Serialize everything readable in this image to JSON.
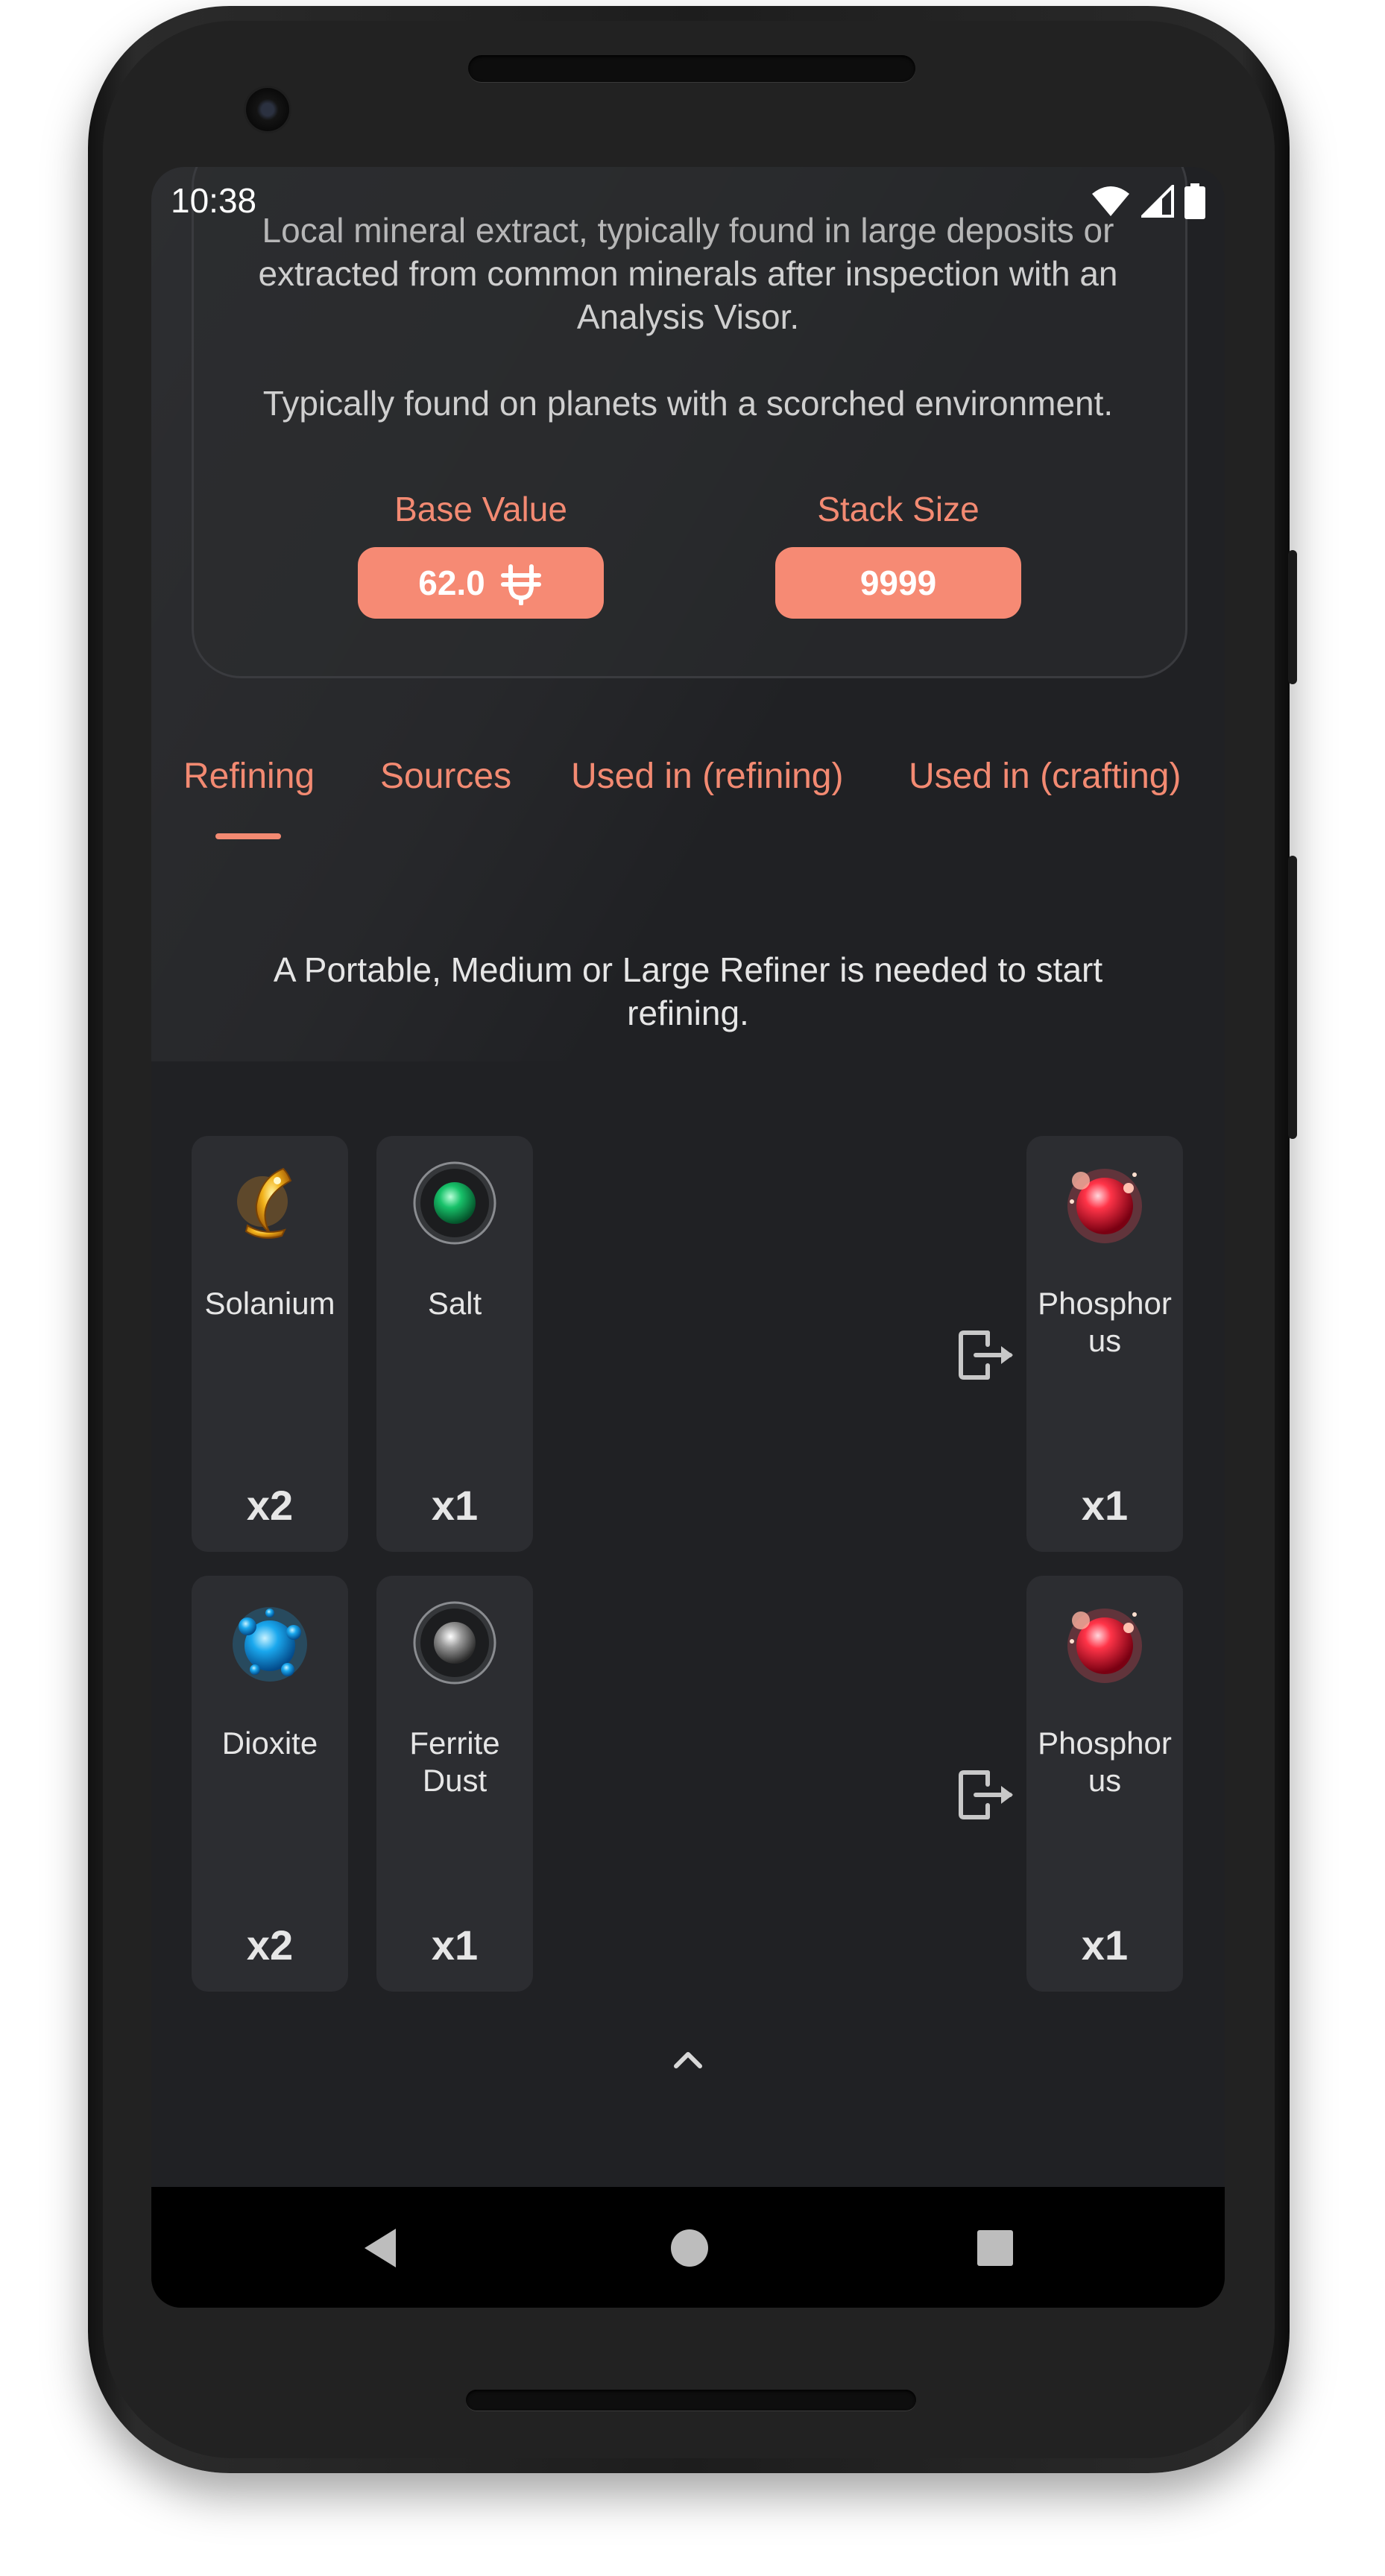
{
  "status_bar": {
    "time": "10:38"
  },
  "item_info": {
    "description_top": "Local mineral extract, typically found in large deposits or",
    "description_mid_1": "extracted from common minerals after inspection with an",
    "description_mid_2": "Analysis Visor.",
    "environment": "Typically found on planets with a scorched environment.",
    "base_value_label": "Base Value",
    "base_value": "62.0",
    "stack_size_label": "Stack Size",
    "stack_size": "9999"
  },
  "tabs": [
    {
      "label": "Refining",
      "selected": true
    },
    {
      "label": "Sources",
      "selected": false
    },
    {
      "label": "Used in (refining)",
      "selected": false
    },
    {
      "label": "Used in (crafting)",
      "selected": false
    }
  ],
  "refining": {
    "note_line_1": "A Portable, Medium or Large Refiner is needed to start",
    "note_line_2": "refining.",
    "recipes": [
      {
        "inputs": [
          {
            "name": "Solanium",
            "qty": "x2",
            "icon": "solanium-icon"
          },
          {
            "name": "Salt",
            "qty": "x1",
            "icon": "salt-icon"
          }
        ],
        "output": {
          "name_line_1": "Phosphor",
          "name_line_2": "us",
          "qty": "x1",
          "icon": "phosphorus-icon"
        }
      },
      {
        "inputs": [
          {
            "name": "Dioxite",
            "qty": "x2",
            "icon": "dioxite-icon"
          },
          {
            "name_line_1": "Ferrite",
            "name_line_2": "Dust",
            "qty": "x1",
            "icon": "ferrite-dust-icon"
          }
        ],
        "output": {
          "name_line_1": "Phosphor",
          "name_line_2": "us",
          "qty": "x1",
          "icon": "phosphorus-icon"
        }
      }
    ]
  },
  "colors": {
    "accent": "#f38a72",
    "background": "#202124",
    "tile": "#2c2d31"
  },
  "navigation": {
    "back": "back-icon",
    "home": "home-icon",
    "recents": "recents-icon"
  }
}
